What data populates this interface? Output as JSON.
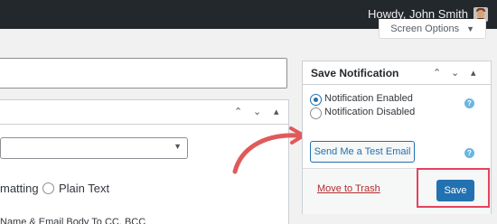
{
  "adminbar": {
    "greeting": "Howdy, John Smith"
  },
  "screen_options": {
    "label": "Screen Options",
    "caret": "▼"
  },
  "left_box": {
    "controls": [
      "⌃",
      "⌄",
      "▴"
    ],
    "radio_left_label": "matting",
    "radio_plain_label": "Plain Text",
    "cut_text": "Name & Email Body To CC, BCC"
  },
  "notification_box": {
    "title": "Save Notification",
    "controls": [
      "⌃",
      "⌄",
      "▴"
    ],
    "radio_enabled": "Notification Enabled",
    "radio_disabled": "Notification Disabled",
    "help_glyph": "?",
    "test_button": "Send Me a Test Email",
    "trash_link": "Move to Trash",
    "save_button": "Save"
  },
  "colors": {
    "admin_bar": "#23282d",
    "primary": "#2271b1",
    "trash": "#b32d2e",
    "highlight": "#e8405e",
    "arrow": "#e05a5a"
  }
}
